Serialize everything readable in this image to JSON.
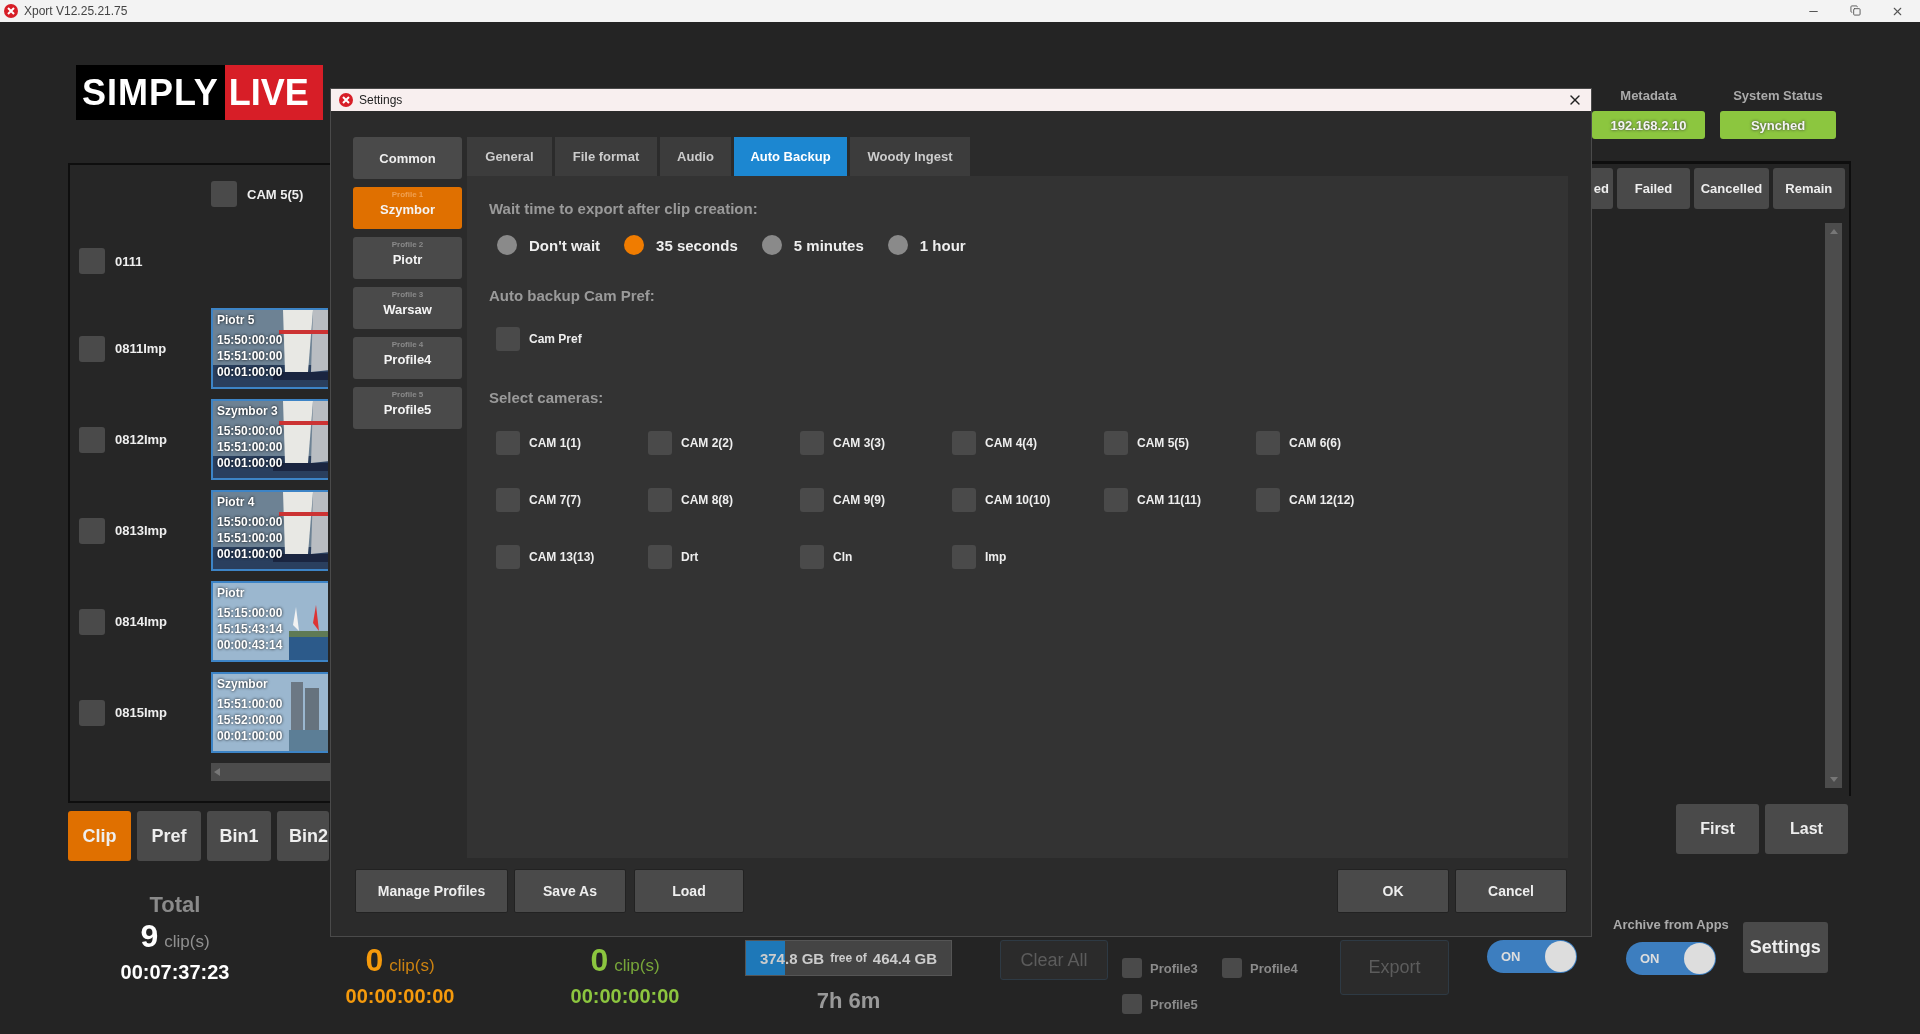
{
  "window": {
    "title": "Xport V12.25.21.75"
  },
  "logo": {
    "word_1": "SIMPLY",
    "word_2": "LIVE"
  },
  "clip_panel": {
    "camera": {
      "label": "CAM 5(5)",
      "checked": false
    },
    "rows": [
      {
        "label": "0111",
        "checked": false
      },
      {
        "label": "0811Imp",
        "checked": false,
        "clip": {
          "name": "Piotr 5",
          "tc_in": "15:50:00:00",
          "tc_out": "15:51:00:00",
          "duration": "00:01:00:00"
        }
      },
      {
        "label": "0812Imp",
        "checked": false,
        "clip": {
          "name": "Szymbor 3",
          "tc_in": "15:50:00:00",
          "tc_out": "15:51:00:00",
          "duration": "00:01:00:00"
        }
      },
      {
        "label": "0813Imp",
        "checked": false,
        "clip": {
          "name": "Piotr 4",
          "tc_in": "15:50:00:00",
          "tc_out": "15:51:00:00",
          "duration": "00:01:00:00"
        }
      },
      {
        "label": "0814Imp",
        "checked": false,
        "clip": {
          "name": "Piotr",
          "tc_in": "15:15:00:00",
          "tc_out": "15:15:43:14",
          "duration": "00:00:43:14"
        }
      },
      {
        "label": "0815Imp",
        "checked": false,
        "clip": {
          "name": "Szymbor",
          "tc_in": "15:51:00:00",
          "tc_out": "15:52:00:00",
          "duration": "00:01:00:00"
        }
      }
    ]
  },
  "bins": [
    {
      "label": "Clip",
      "selected": true
    },
    {
      "label": "Pref",
      "selected": false
    },
    {
      "label": "Bin1",
      "selected": false
    },
    {
      "label": "Bin2",
      "selected": false
    }
  ],
  "totals": [
    {
      "title": "Total",
      "count": "9",
      "unit": "clip(s)",
      "time": "00:07:37:23",
      "color": "#ffffff"
    },
    {
      "count": "0",
      "unit": "clip(s)",
      "time": "00:00:00:00",
      "color": "#f59a0c"
    },
    {
      "count": "0",
      "unit": "clip(s)",
      "time": "00:00:00:00",
      "color": "#8cc63f"
    }
  ],
  "storage": {
    "free": "374.8 GB",
    "free_of": "free of",
    "total": "464.4 GB",
    "level": 0.19,
    "remaining": "7h 6m"
  },
  "clear_all": {
    "label": "Clear All",
    "disabled": true
  },
  "export_profiles": [
    {
      "label": "Profile3",
      "checked": false
    },
    {
      "label": "Profile4",
      "checked": false
    },
    {
      "label": "Profile5",
      "checked": false
    }
  ],
  "export": {
    "label": "Export",
    "disabled": true
  },
  "toggle": {
    "label": "ON",
    "on": true
  },
  "archive": {
    "label": "Archive from Apps",
    "toggle": {
      "label": "ON",
      "on": true
    }
  },
  "settings_button": "Settings",
  "status": [
    {
      "label": "Metadata",
      "value": "192.168.2.10"
    },
    {
      "label": "System Status",
      "value": "Synched"
    }
  ],
  "job_columns": [
    "ed",
    "Failed",
    "Cancelled",
    "Remain"
  ],
  "nav_buttons": [
    "First",
    "Last"
  ],
  "dialog": {
    "title": "Settings",
    "common": "Common",
    "profiles": [
      {
        "number": "Profile 1",
        "name": "Szymbor",
        "selected": true
      },
      {
        "number": "Profile 2",
        "name": "Piotr",
        "selected": false
      },
      {
        "number": "Profile 3",
        "name": "Warsaw",
        "selected": false
      },
      {
        "number": "Profile 4",
        "name": "Profile4",
        "selected": false
      },
      {
        "number": "Profile 5",
        "name": "Profile5",
        "selected": false
      }
    ],
    "tabs": [
      {
        "label": "General",
        "selected": false
      },
      {
        "label": "File format",
        "selected": false
      },
      {
        "label": "Audio",
        "selected": false
      },
      {
        "label": "Auto Backup",
        "selected": true
      },
      {
        "label": "Woody Ingest",
        "selected": false
      }
    ],
    "wait": {
      "heading": "Wait time to export after clip creation:",
      "options": [
        {
          "label": "Don't wait",
          "selected": false
        },
        {
          "label": "35 seconds",
          "selected": true
        },
        {
          "label": "5 minutes",
          "selected": false
        },
        {
          "label": "1 hour",
          "selected": false
        }
      ]
    },
    "cam_pref": {
      "heading": "Auto backup Cam Pref:",
      "label": "Cam Pref",
      "checked": false
    },
    "cameras": {
      "heading": "Select cameras:",
      "items": [
        {
          "label": "CAM 1(1)",
          "checked": false
        },
        {
          "label": "CAM 2(2)",
          "checked": false
        },
        {
          "label": "CAM 3(3)",
          "checked": false
        },
        {
          "label": "CAM 4(4)",
          "checked": false
        },
        {
          "label": "CAM 5(5)",
          "checked": false
        },
        {
          "label": "CAM 6(6)",
          "checked": false
        },
        {
          "label": "CAM 7(7)",
          "checked": false
        },
        {
          "label": "CAM 8(8)",
          "checked": false
        },
        {
          "label": "CAM 9(9)",
          "checked": false
        },
        {
          "label": "CAM 10(10)",
          "checked": false
        },
        {
          "label": "CAM 11(11)",
          "checked": false
        },
        {
          "label": "CAM 12(12)",
          "checked": false
        },
        {
          "label": "CAM 13(13)",
          "checked": false
        },
        {
          "label": "Drt",
          "checked": false
        },
        {
          "label": "Cln",
          "checked": false
        },
        {
          "label": "Imp",
          "checked": false
        }
      ]
    },
    "footer_left": [
      "Manage Profiles",
      "Save As",
      "Load"
    ],
    "footer_right": [
      "OK",
      "Cancel"
    ]
  }
}
